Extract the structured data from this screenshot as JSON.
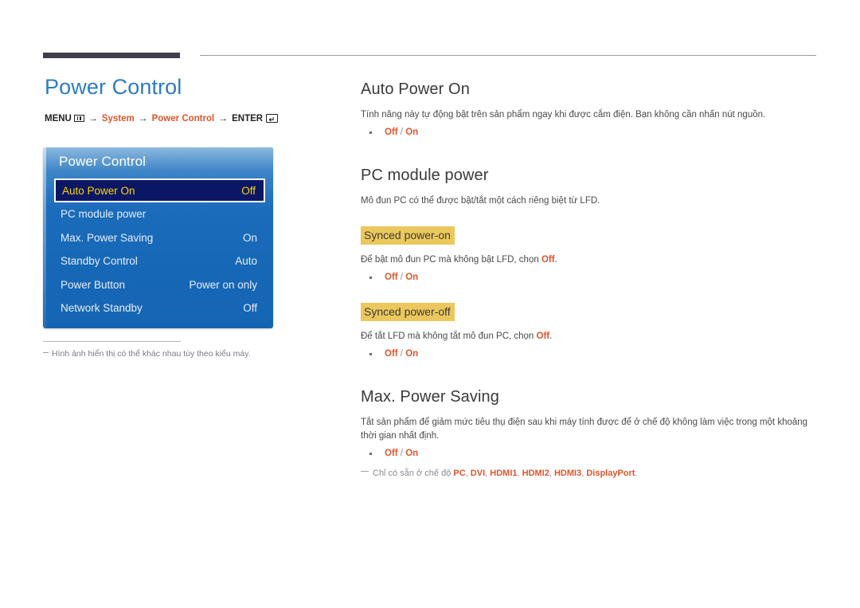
{
  "page": {
    "title": "Power Control"
  },
  "breadcrumb": {
    "menu_label": "MENU",
    "menu_icon": "menu-grid-icon",
    "arrow": "→",
    "step1": "System",
    "step2": "Power Control",
    "enter_label": "ENTER",
    "enter_icon": "enter-key-icon",
    "enter_glyph": "↵"
  },
  "osd": {
    "title": "Power Control",
    "rows": [
      {
        "label": "Auto Power On",
        "value": "Off",
        "selected": true
      },
      {
        "label": "PC module power",
        "value": "",
        "selected": false
      },
      {
        "label": "Max. Power Saving",
        "value": "On",
        "selected": false
      },
      {
        "label": "Standby Control",
        "value": "Auto",
        "selected": false
      },
      {
        "label": "Power Button",
        "value": "Power on only",
        "selected": false
      },
      {
        "label": "Network Standby",
        "value": "Off",
        "selected": false
      }
    ]
  },
  "left_note": {
    "text": "Hình ảnh hiển thị có thể khác nhau tùy theo kiểu máy."
  },
  "sections": {
    "auto_power_on": {
      "heading": "Auto Power On",
      "body": "Tính năng này tự động bật trên sản phẩm ngay khi được cắm điện. Bạn không cần nhấn nút nguồn.",
      "opt_off": "Off",
      "opt_sep": " / ",
      "opt_on": "On"
    },
    "pc_module_power": {
      "heading": "PC module power",
      "body": "Mô đun PC có thể được bật/tắt một cách riêng biệt từ LFD.",
      "synced_power_on": {
        "subhead": "Synced power-on",
        "body_pre": "Để bật mô đun PC mà không bật LFD, chọn ",
        "body_accent": "Off",
        "body_post": ".",
        "opt_off": "Off",
        "opt_sep": " / ",
        "opt_on": "On"
      },
      "synced_power_off": {
        "subhead": "Synced power-off",
        "body_pre": "Để tắt LFD mà không tắt mô đun PC, chọn ",
        "body_accent": "Off",
        "body_post": ".",
        "opt_off": "Off",
        "opt_sep": " / ",
        "opt_on": "On"
      }
    },
    "max_power_saving": {
      "heading": "Max. Power Saving",
      "body": "Tắt sản phẩm để giảm mức tiêu thụ điện sau khi máy tính được để ở chế độ không làm việc trong một khoảng thời gian nhất định.",
      "opt_off": "Off",
      "opt_sep": " / ",
      "opt_on": "On",
      "footnote_pre": "Chỉ có sẵn ở chế độ ",
      "footnote_modes": [
        "PC",
        "DVI",
        "HDMI1",
        "HDMI2",
        "HDMI3",
        "DisplayPort"
      ],
      "footnote_sep": ", ",
      "footnote_post": "."
    }
  },
  "colors": {
    "title_blue": "#2d7cc3",
    "accent_orange": "#e0552b",
    "osd_blue": "#1667b6",
    "osd_selected_bg": "#0b1765",
    "osd_selected_text": "#ffd400",
    "subhead_highlight": "#ecc85c",
    "rule_dark": "#413d4b"
  }
}
